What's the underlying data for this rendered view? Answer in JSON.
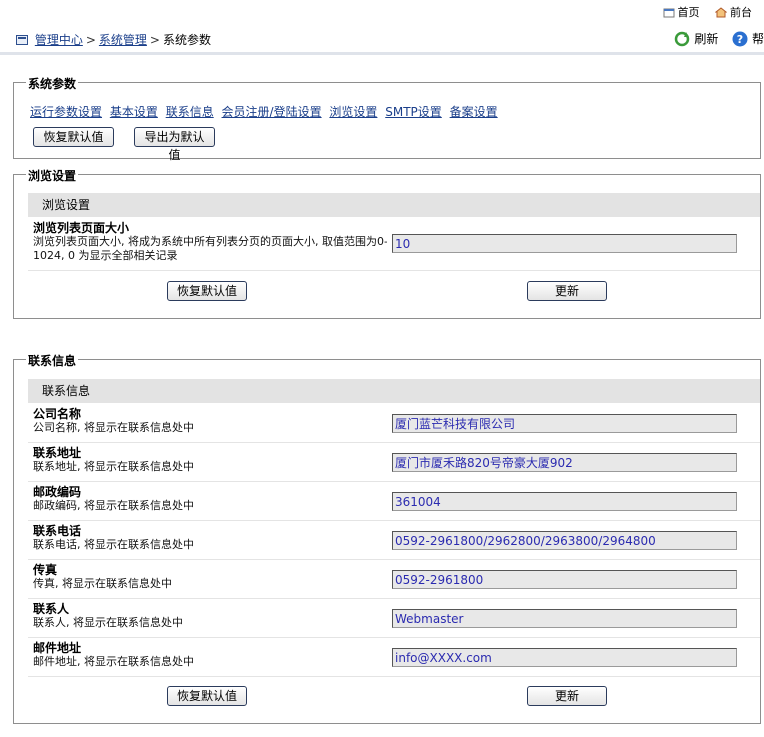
{
  "top_links": {
    "home": "首页",
    "front": "前台"
  },
  "breadcrumb": {
    "level1": "管理中心",
    "level2": "系统管理",
    "current": "系统参数"
  },
  "tools": {
    "refresh": "刷新",
    "help": "帮"
  },
  "params": {
    "legend": "系统参数",
    "nav": [
      "运行参数设置",
      "基本设置",
      "联系信息",
      "会员注册/登陆设置",
      "浏览设置",
      "SMTP设置",
      "备案设置"
    ],
    "restore_label": "恢复默认值",
    "export_label": "导出为默认值"
  },
  "browse": {
    "legend": "浏览设置",
    "table_title": "浏览设置",
    "rows": [
      {
        "title": "浏览列表页面大小",
        "desc": "浏览列表页面大小, 将成为系统中所有列表分页的页面大小, 取值范围为0-1024, 0 为显示全部相关记录",
        "value": "10"
      }
    ],
    "restore_label": "恢复默认值",
    "update_label": "更新"
  },
  "contact": {
    "legend": "联系信息",
    "table_title": "联系信息",
    "rows": [
      {
        "title": "公司名称",
        "desc": "公司名称, 将显示在联系信息处中",
        "value": "厦门蓝芒科技有限公司"
      },
      {
        "title": "联系地址",
        "desc": "联系地址, 将显示在联系信息处中",
        "value": "厦门市厦禾路820号帝豪大厦902"
      },
      {
        "title": "邮政编码",
        "desc": "邮政编码, 将显示在联系信息处中",
        "value": "361004"
      },
      {
        "title": "联系电话",
        "desc": "联系电话, 将显示在联系信息处中",
        "value": "0592-2961800/2962800/2963800/2964800"
      },
      {
        "title": "传真",
        "desc": "传真, 将显示在联系信息处中",
        "value": "0592-2961800"
      },
      {
        "title": "联系人",
        "desc": "联系人, 将显示在联系信息处中",
        "value": "Webmaster"
      },
      {
        "title": "邮件地址",
        "desc": "邮件地址, 将显示在联系信息处中",
        "value": "info@XXXX.com"
      }
    ],
    "restore_label": "恢复默认值",
    "update_label": "更新"
  }
}
